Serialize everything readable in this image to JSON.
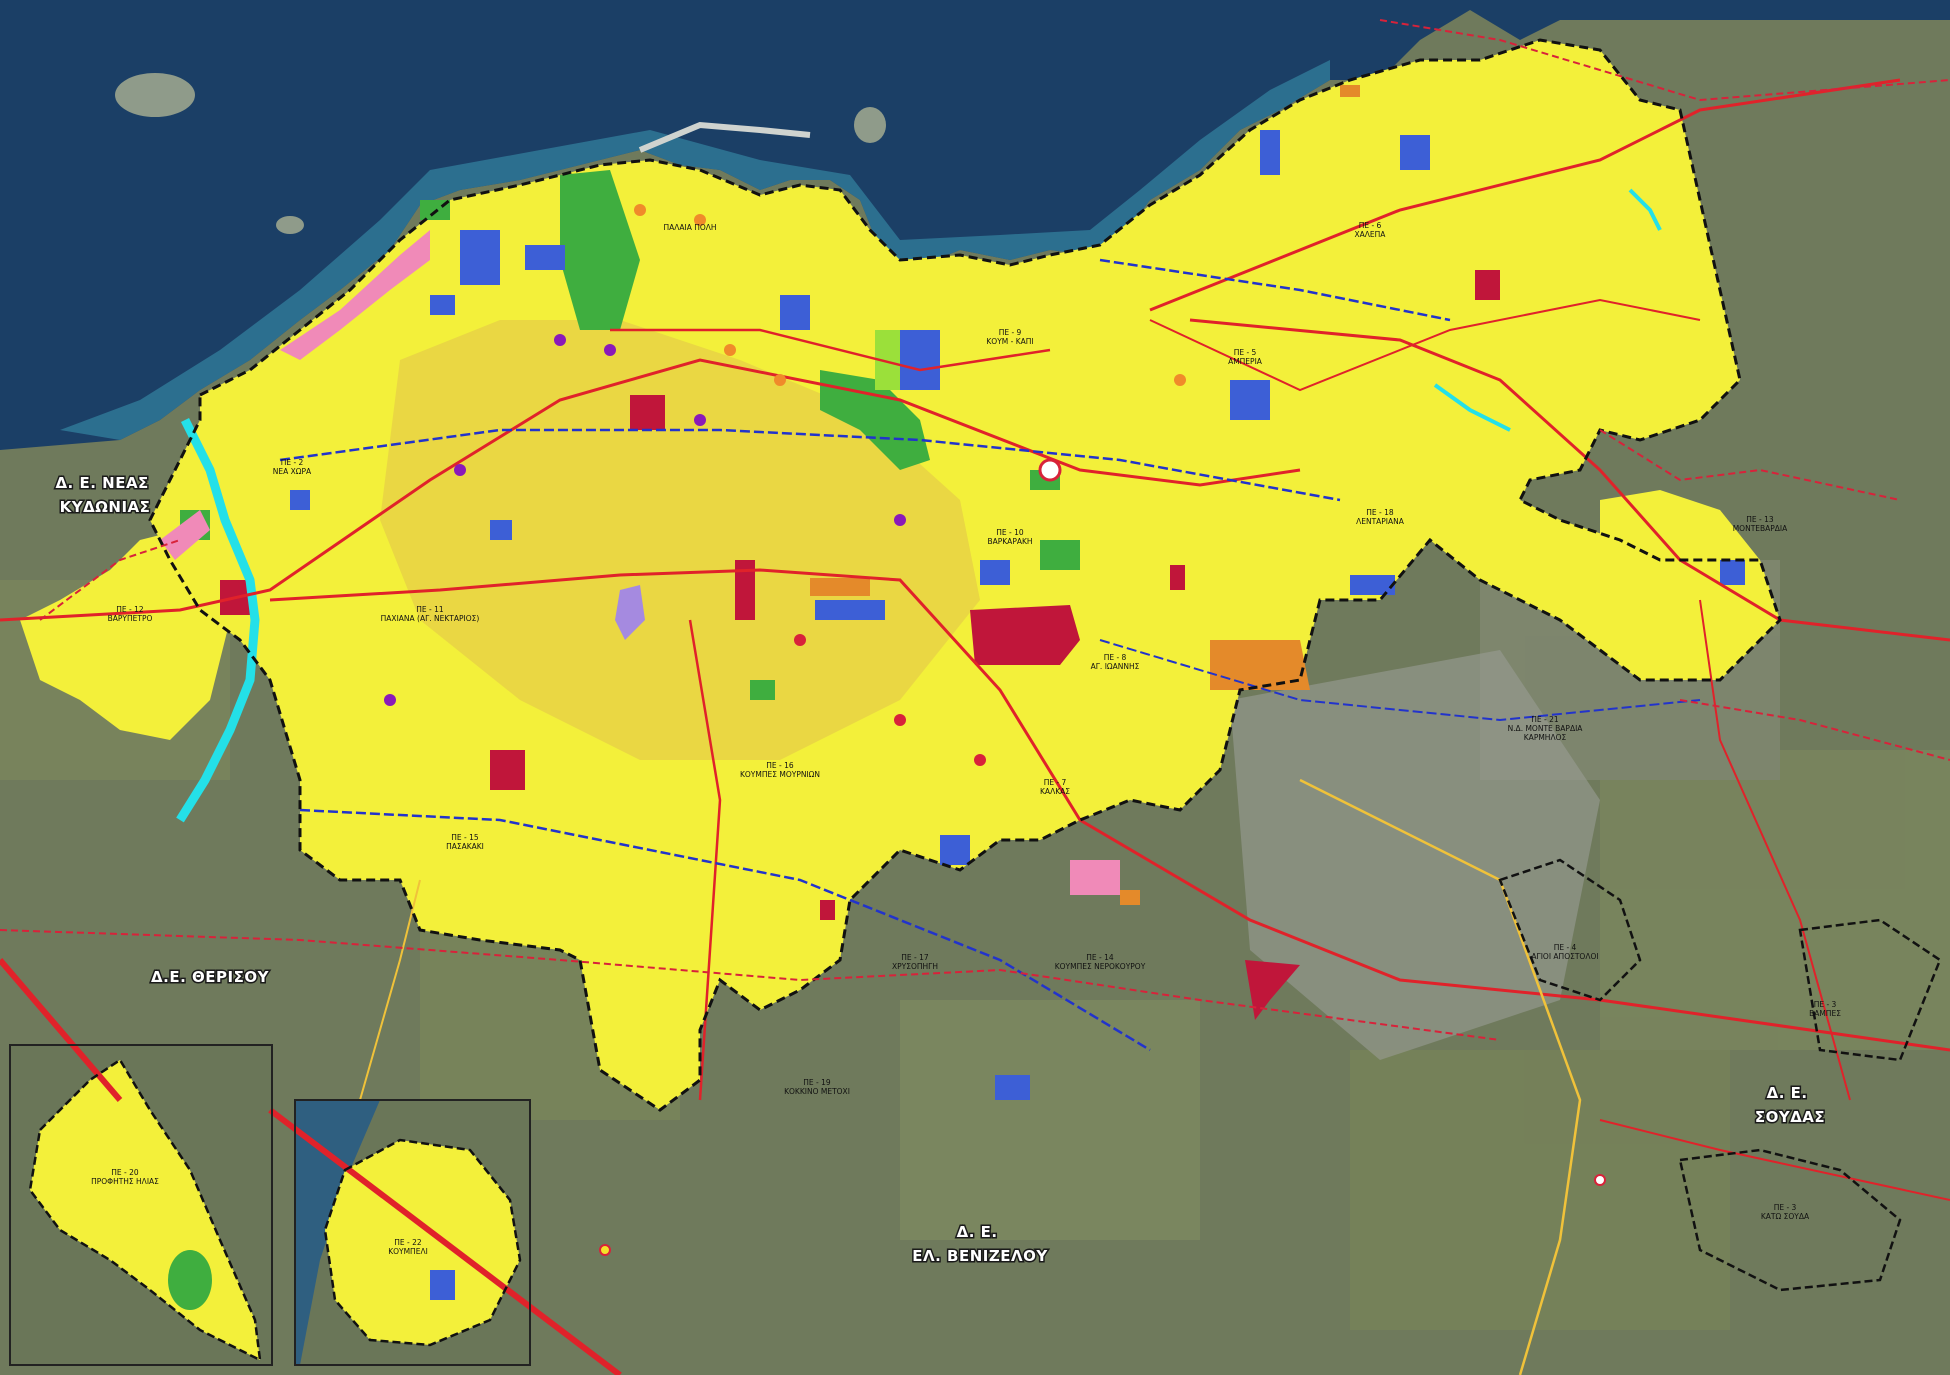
{
  "colors": {
    "sea_deep": "#1b3f66",
    "sea_shallow": "#2f7896",
    "land": "#6f7a5c",
    "urban": "#f3f03a",
    "urban_dense": "#e1c34a",
    "green_zone": "#3fae3f",
    "education_blue": "#3d5fd6",
    "public_red": "#c0163a",
    "sport_orange": "#e48a2a",
    "heritage_pink": "#f08ab8",
    "boundary_black": "#111111",
    "boundary_red": "#d8223a",
    "road_red": "#e0222a",
    "road_blue": "#2233cc",
    "road_yellow": "#f0c23a",
    "river_cyan": "#24e0e8"
  },
  "labels": {
    "municipal_areas": [
      {
        "id": "nea-kydonia",
        "lines": [
          "Δ. Ε. ΝΕΑΣ",
          "ΚΥΔΩΝΙΑΣ"
        ]
      },
      {
        "id": "therisou",
        "lines": [
          "Δ.Ε. ΘΕΡΙΣΟΥ"
        ]
      },
      {
        "id": "souda",
        "lines": [
          "Δ. Ε.",
          "ΣΟΥΔΑΣ"
        ]
      },
      {
        "id": "venizelou",
        "lines": [
          "Δ. Ε.",
          "ΕΛ. ΒΕΝΙΖΕΛΟΥ"
        ]
      }
    ],
    "districts": [
      {
        "id": "pe2",
        "lines": [
          "ΠΕ - 2",
          "ΝΕΑ ΧΩΡΑ"
        ]
      },
      {
        "id": "pe11",
        "lines": [
          "ΠΕ - 11",
          "ΠΑΧΙΑΝΑ (ΑΓ. ΝΕΚΤΑΡΙΟΣ)"
        ]
      },
      {
        "id": "pe8",
        "lines": [
          "ΠΕ - 8",
          "ΑΓ. ΙΩΑΝΝΗΣ"
        ]
      },
      {
        "id": "pe13",
        "lines": [
          "ΠΕ - 13",
          "ΜΟΝΤΕΒΑΡΔΙΑ"
        ]
      },
      {
        "id": "pe18",
        "lines": [
          "ΠΕ - 18",
          "ΛΕΝΤΑΡΙΑΝΑ"
        ]
      },
      {
        "id": "pe21",
        "lines": [
          "ΠΕ - 21",
          "Ν.Δ. ΜΟΝΤΕ ΒΑΡΔΙΑ",
          "ΚΑΡΜΗΛΟΣ"
        ]
      },
      {
        "id": "pe16",
        "lines": [
          "ΠΕ - 16",
          "ΚΟΥΜΠΕΣ ΜΟΥΡΝΙΩΝ"
        ]
      },
      {
        "id": "pe7",
        "lines": [
          "ΠΕ - 7",
          "ΚΑΛΚΑΣ"
        ]
      },
      {
        "id": "pe15",
        "lines": [
          "ΠΕ - 15",
          "ΠΑΣΑΚΑΚΙ"
        ]
      },
      {
        "id": "pe17",
        "lines": [
          "ΠΕ - 17",
          "ΧΡΥΣΟΠΗΓΗ"
        ]
      },
      {
        "id": "pe14",
        "lines": [
          "ΠΕ - 14",
          "ΚΟΥΜΠΕΣ ΝΕΡΟΚΟΥΡΟΥ"
        ]
      },
      {
        "id": "pe4",
        "lines": [
          "ΠΕ - 4",
          "ΑΓΙΟΙ ΑΠΟΣΤΟΛΟΙ"
        ]
      },
      {
        "id": "pe5",
        "lines": [
          "ΠΕ - 5",
          "ΑΜΠΕΡΙΑ"
        ]
      },
      {
        "id": "pe6",
        "lines": [
          "ΠΕ - 6",
          "ΧΑΛΕΠΑ"
        ]
      },
      {
        "id": "pe9",
        "lines": [
          "ΠΕ - 9",
          "ΚΟΥΜ - ΚΑΠΙ"
        ]
      },
      {
        "id": "pe1",
        "lines": [
          "ΠΑΛΑΙΑ ΠΟΛΗ"
        ]
      },
      {
        "id": "pe10",
        "lines": [
          "ΠΕ - 10",
          "ΒΑΡΚΑΡΑΚΗ"
        ]
      },
      {
        "id": "pe19",
        "lines": [
          "ΠΕ - 19",
          "ΚΟΚΚΙΝΟ ΜΕΤΟΧΙ"
        ]
      },
      {
        "id": "pe20",
        "lines": [
          "ΠΕ - 20",
          "ΠΡΟΦΗΤΗΣ ΗΛΙΑΣ"
        ]
      },
      {
        "id": "pe22",
        "lines": [
          "ΠΕ - 22",
          "ΚΟΥΜΠΕΛΙ"
        ]
      },
      {
        "id": "pe3",
        "lines": [
          "ΠΕ - 3",
          "ΒΑΜΠΕΣ"
        ]
      },
      {
        "id": "pe3b",
        "lines": [
          "ΠΕ - 3",
          "ΚΑΤΩ ΣΟΥΔΑ"
        ]
      },
      {
        "id": "pe12",
        "lines": [
          "ΠΕ - 12",
          "ΒΑΡΥΠΕΤΡΟ"
        ]
      }
    ]
  }
}
